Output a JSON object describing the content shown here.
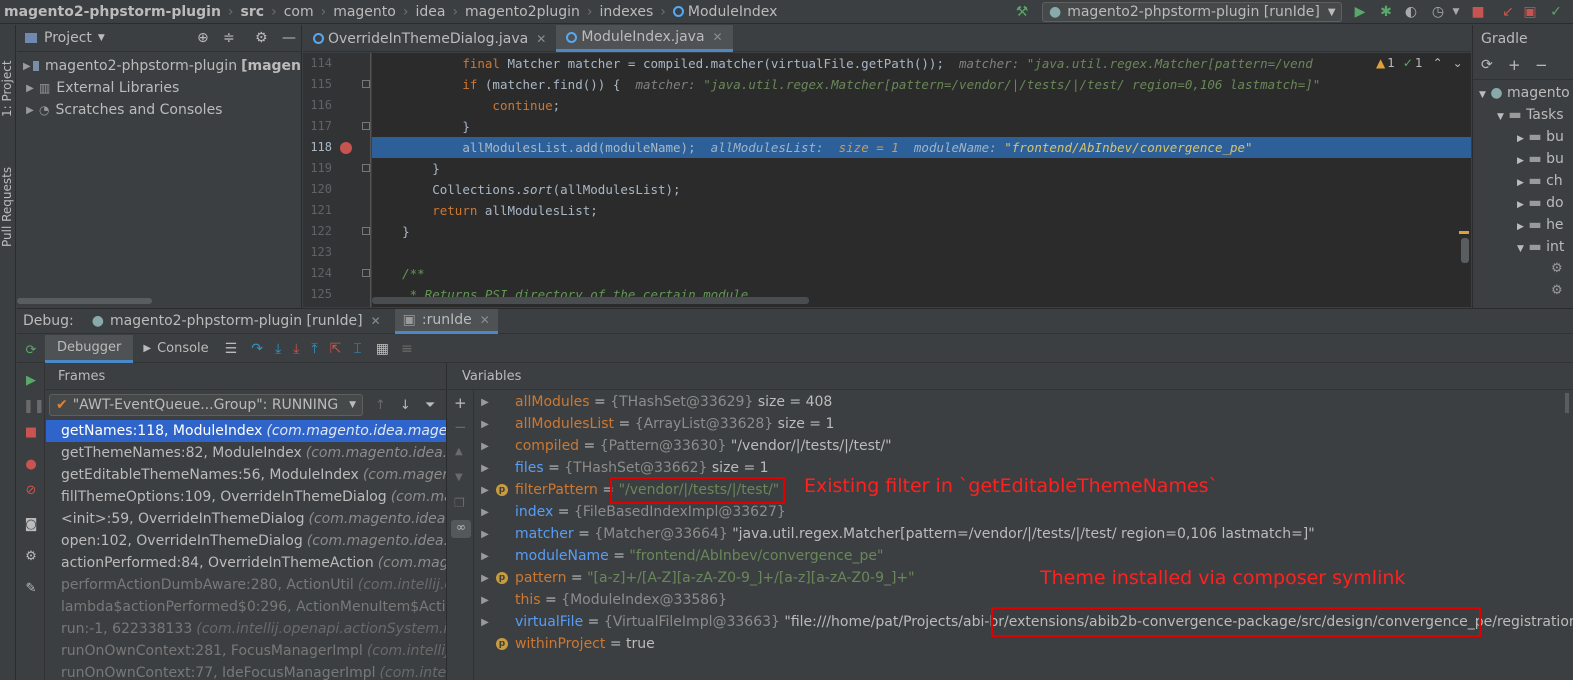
{
  "navbar": {
    "crumbs": [
      "magento2-phpstorm-plugin",
      "src",
      "com",
      "magento",
      "idea",
      "magento2plugin",
      "indexes",
      "ModuleIndex"
    ],
    "run_config": "magento2-phpstorm-plugin [runIde]"
  },
  "left_stripe": {
    "project": "1: Project",
    "pull_requests": "Pull Requests"
  },
  "project": {
    "title": "Project",
    "items": [
      {
        "label": "magento2-phpstorm-plugin",
        "suffix": "[magen"
      },
      {
        "label": "External Libraries"
      },
      {
        "label": "Scratches and Consoles"
      }
    ]
  },
  "editor": {
    "tabs": [
      {
        "label": "OverrideInThemeDialog.java"
      },
      {
        "label": "ModuleIndex.java"
      }
    ],
    "line_numbers": [
      "114",
      "115",
      "116",
      "117",
      "118",
      "119",
      "120",
      "121",
      "122",
      "123",
      "124",
      "125"
    ],
    "inspection": {
      "warnings": "1",
      "ok": "1"
    },
    "code": {
      "l114_kw": "final",
      "l114_code": " Matcher matcher = compiled.matcher(virtualFile.getPath());",
      "l114_dbg": "matcher:",
      "l114_val": "\"java.util.regex.Matcher[pattern=/vend",
      "l115_kw": "if",
      "l115_code": " (matcher.find()) {",
      "l115_dbg": "matcher:",
      "l115_val": "\"java.util.regex.Matcher[pattern=/vendor/|/tests/|/test/ region=0,106 lastmatch=]\"",
      "l116_kw": "continue",
      "l116_code": ";",
      "l117": "}",
      "l118_code": "allModulesList.add(moduleName);",
      "l118_dbg1": "allModulesList:",
      "l118_dbg2": "size = 1",
      "l118_dbg3": "moduleName:",
      "l118_val": "\"frontend/AbInbev/convergence_pe\"",
      "l119": "}",
      "l120_pre": "Collections.",
      "l120_fn": "sort",
      "l120_post": "(allModulesList);",
      "l121_kw": "return",
      "l121_code": " allModulesList;",
      "l122": "}",
      "l124": "/**",
      "l125": " * Returns PSI directory of the certain module."
    }
  },
  "gradle": {
    "title": "Gradle",
    "root": "magento",
    "tasks": "Tasks",
    "children": [
      "bu",
      "bu",
      "ch",
      "do",
      "he",
      "int"
    ]
  },
  "debug": {
    "label": "Debug:",
    "session_tab": "magento2-phpstorm-plugin [runIde]",
    "run_tab": ":runIde",
    "debugger_tab": "Debugger",
    "console_tab": "Console",
    "frames_title": "Frames",
    "thread": "\"AWT-EventQueue...Group\": RUNNING",
    "frames": [
      {
        "method": "getNames:118, ModuleIndex",
        "pkg": "(com.magento.idea.magento"
      },
      {
        "method": "getThemeNames:82, ModuleIndex",
        "pkg": "(com.magento.idea.ma"
      },
      {
        "method": "getEditableThemeNames:56, ModuleIndex",
        "pkg": "(com.magento."
      },
      {
        "method": "fillThemeOptions:109, OverrideInThemeDialog",
        "pkg": "(com.mag"
      },
      {
        "method": "<init>:59, OverrideInThemeDialog",
        "pkg": "(com.magento.idea.ma"
      },
      {
        "method": "open:102, OverrideInThemeDialog",
        "pkg": "(com.magento.idea.ma"
      },
      {
        "method": "actionPerformed:84, OverrideInThemeAction",
        "pkg": "(com.mage"
      },
      {
        "method": "performActionDumbAware:280, ActionUtil",
        "pkg": "(com.intellij.o"
      },
      {
        "method": "lambda$actionPerformed$0:296, ActionMenuItem$Actio",
        "pkg": ""
      },
      {
        "method": "run:-1, 622338133",
        "pkg": "(com.intellij.openapi.actionSystem.impl.A"
      },
      {
        "method": "runOnOwnContext:281, FocusManagerImpl",
        "pkg": "(com.intellij.o"
      },
      {
        "method": "runOnOwnContext:77, IdeFocusManagerImpl",
        "pkg": "(com.intelli"
      }
    ],
    "variables_title": "Variables",
    "variables": [
      {
        "name": "allModules",
        "type": "{THashSet@33629}",
        "value": "size = 408"
      },
      {
        "name": "allModulesList",
        "type": "{ArrayList@33628}",
        "value": "size = 1"
      },
      {
        "name": "compiled",
        "type": "{Pattern@33630}",
        "value": "\"/vendor/|/tests/|/test/\""
      },
      {
        "name": "files",
        "type": "{THashSet@33662}",
        "value": "size = 1"
      },
      {
        "name": "filterPattern",
        "type": "",
        "value": "\"/vendor/|/tests/|/test/\""
      },
      {
        "name": "index",
        "type": "{FileBasedIndexImpl@33627}",
        "value": ""
      },
      {
        "name": "matcher",
        "type": "{Matcher@33664}",
        "value": "\"java.util.regex.Matcher[pattern=/vendor/|/tests/|/test/ region=0,106 lastmatch=]\""
      },
      {
        "name": "moduleName",
        "type": "",
        "value": "\"frontend/AbInbev/convergence_pe\""
      },
      {
        "name": "pattern",
        "type": "",
        "value": "\"[a-z]+/[A-Z][a-zA-Z0-9_]+/[a-z][a-zA-Z0-9_]+\""
      },
      {
        "name": "this",
        "type": "{ModuleIndex@33586}",
        "value": ""
      },
      {
        "name": "virtualFile",
        "type": "{VirtualFileImpl@33663}",
        "value": "\"file:///home/pat/Projects/abi-b2b/extensions/abib2b-convergence-package/src/design/convergence_pe/registration"
      },
      {
        "name": "withinProject",
        "type": "",
        "value": "true"
      }
    ],
    "virtualfile_prefix": "\"file:///home/pat/Projects/abi-br",
    "virtualfile_boxed": "/extensions/abib2b-convergence-package/src/design/convergence_pe/",
    "virtualfile_suffix": "registration"
  },
  "annotations": {
    "filter_note": "Existing filter in `getEditableThemeNames`",
    "theme_note": "Theme installed via composer symlink",
    "color": "#ff2020"
  }
}
